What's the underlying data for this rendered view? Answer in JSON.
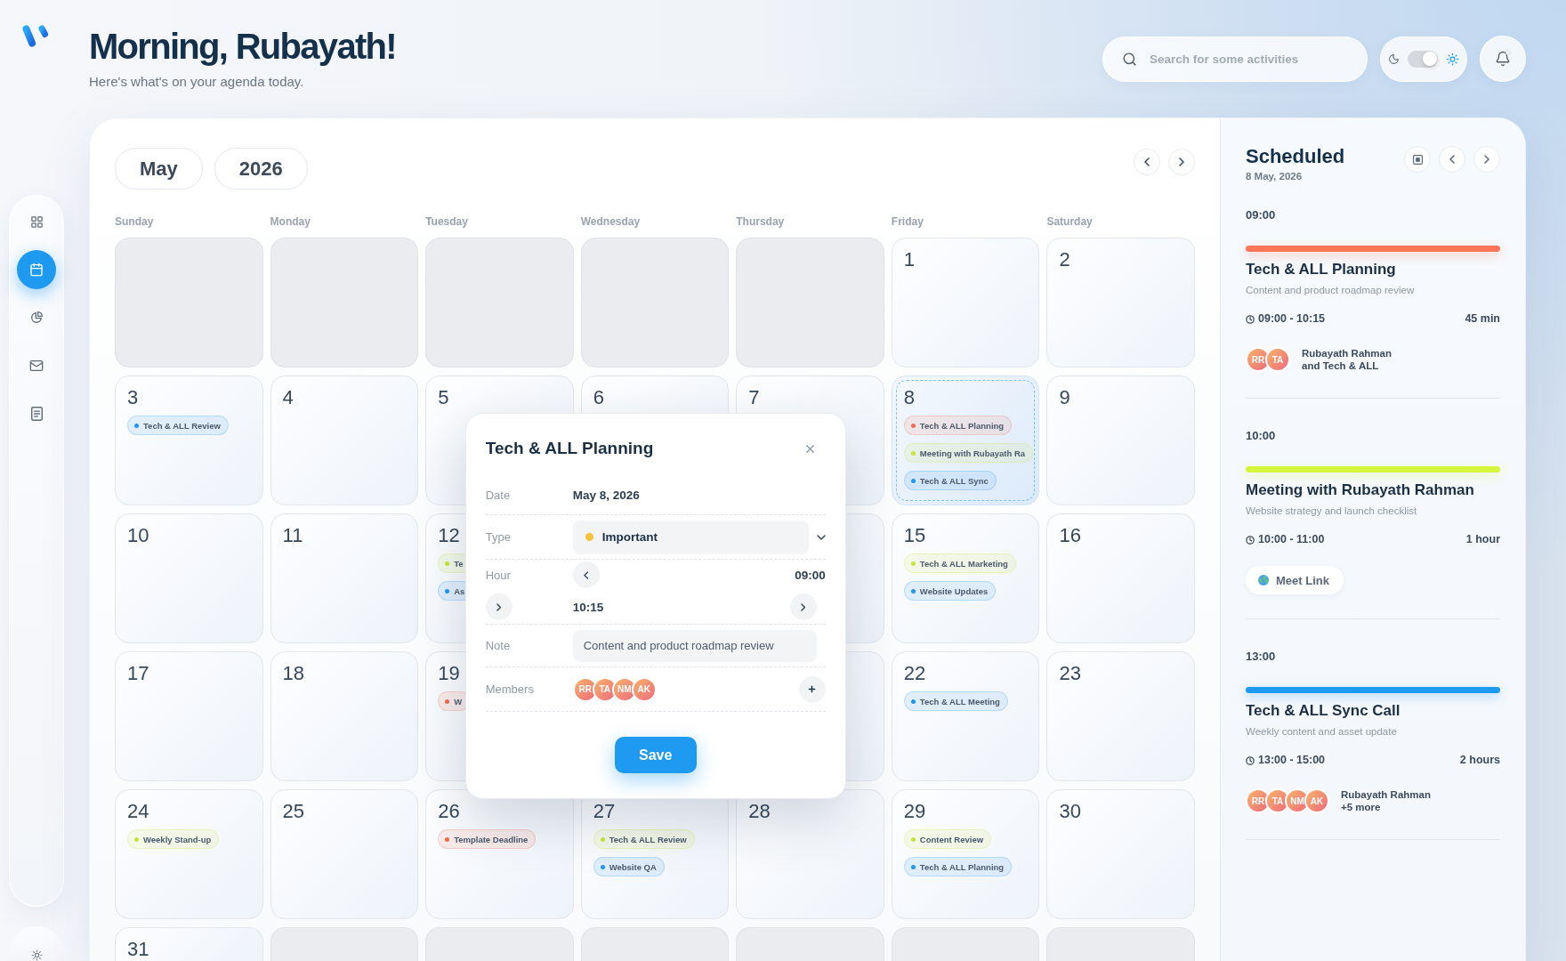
{
  "header": {
    "title": "Morning, Rubayath!",
    "subtitle": "Here's what's on your agenda today."
  },
  "search": {
    "placeholder": "Search for some activities"
  },
  "theme_toggle": {
    "light": true
  },
  "notifications": {
    "unread": true
  },
  "sidebar": {
    "items": [
      {
        "kind": "dashboard",
        "selected": false
      },
      {
        "kind": "calendar",
        "selected": true
      },
      {
        "kind": "analytics",
        "selected": false
      },
      {
        "kind": "mail",
        "selected": false
      },
      {
        "kind": "documents",
        "selected": false
      }
    ]
  },
  "calendar": {
    "month": "May",
    "year": "2026",
    "weekdays": [
      "Sunday",
      "Monday",
      "Tuesday",
      "Wednesday",
      "Thursday",
      "Friday",
      "Saturday"
    ],
    "weeks": [
      [
        {
          "outside": true,
          "selected": false
        },
        {
          "outside": true,
          "selected": false
        },
        {
          "outside": true,
          "selected": false
        },
        {
          "outside": true,
          "selected": false
        },
        {
          "outside": true,
          "selected": false
        },
        {
          "day": "1",
          "outside": false,
          "selected": false
        },
        {
          "day": "2",
          "outside": false,
          "selected": false
        }
      ],
      [
        {
          "day": "3",
          "outside": false,
          "selected": false,
          "events": [
            {
              "title": "Tech & ALL Review",
              "color": "#2196f3"
            }
          ]
        },
        {
          "day": "4",
          "outside": false,
          "selected": false
        },
        {
          "day": "5",
          "outside": false,
          "selected": false
        },
        {
          "day": "6",
          "outside": false,
          "selected": false
        },
        {
          "day": "7",
          "outside": false,
          "selected": false
        },
        {
          "day": "8",
          "outside": false,
          "selected": true,
          "events": [
            {
              "title": "Tech & ALL Planning",
              "color": "#f4694c"
            },
            {
              "title": "Meeting with Rubayath Ra",
              "color": "#c6e637"
            },
            {
              "title": "Tech & ALL Sync",
              "color": "#2196f3"
            }
          ]
        },
        {
          "day": "9",
          "outside": false,
          "selected": false
        }
      ],
      [
        {
          "day": "10",
          "outside": false,
          "selected": false
        },
        {
          "day": "11",
          "outside": false,
          "selected": false
        },
        {
          "day": "12",
          "outside": false,
          "selected": false,
          "events": [
            {
              "title": "Te",
              "color": "#c6e637"
            },
            {
              "title": "As",
              "color": "#2196f3"
            }
          ]
        },
        {
          "outside": false,
          "selected": false
        },
        {
          "day": "15",
          "outside": false,
          "selected": false,
          "events": [
            {
              "title": "Tech & ALL Marketing",
              "color": "#c6e637"
            },
            {
              "title": "Website Updates",
              "color": "#2196f3"
            }
          ]
        },
        {
          "day": "16",
          "outside": false,
          "selected": false
        }
      ],
      [
        {
          "day": "17",
          "outside": false,
          "selected": false
        },
        {
          "day": "18",
          "outside": false,
          "selected": false
        },
        {
          "day": "19",
          "outside": false,
          "selected": false,
          "events": [
            {
              "title": "W",
              "color": "#f4694c"
            }
          ]
        },
        {
          "outside": false,
          "selected": false
        },
        {
          "day": "22",
          "outside": false,
          "selected": false,
          "events": [
            {
              "title": "Tech & ALL Meeting",
              "color": "#2196f3"
            }
          ]
        },
        {
          "day": "23",
          "outside": false,
          "selected": false
        }
      ],
      [
        {
          "day": "24",
          "outside": false,
          "selected": false,
          "events": [
            {
              "title": "Weekly Stand-up",
              "color": "#c6e637"
            }
          ]
        },
        {
          "day": "25",
          "outside": false,
          "selected": false
        },
        {
          "day": "26",
          "outside": false,
          "selected": false,
          "events": [
            {
              "title": "Template Deadline",
              "color": "#f4694c"
            }
          ]
        },
        {
          "day": "27",
          "outside": false,
          "selected": false,
          "events": [
            {
              "title": "Tech & ALL Review",
              "color": "#c6e637"
            },
            {
              "title": "Website QA",
              "color": "#2196f3"
            }
          ]
        },
        {
          "day": "28",
          "outside": false,
          "selected": false
        },
        {
          "day": "29",
          "outside": false,
          "selected": false,
          "events": [
            {
              "title": "Content Review",
              "color": "#c6e637"
            },
            {
              "title": "Tech & ALL Planning",
              "color": "#2196f3"
            }
          ]
        },
        {
          "day": "30",
          "outside": false,
          "selected": false
        }
      ],
      [
        {
          "day": "31",
          "outside": false,
          "selected": false
        },
        {
          "outside": true,
          "selected": false
        },
        {
          "outside": true,
          "selected": false
        },
        {
          "outside": true,
          "selected": false
        },
        {
          "outside": true,
          "selected": false
        },
        {
          "outside": true,
          "selected": false
        },
        {
          "outside": true,
          "selected": false
        }
      ]
    ]
  },
  "modal": {
    "title": "Tech & ALL Planning",
    "fields": [
      {
        "kind": "text",
        "label": "Date",
        "value": "May 8, 2026"
      },
      {
        "kind": "select",
        "label": "Type",
        "value": "Important",
        "color": "#f7c23b"
      },
      {
        "kind": "hours",
        "label": "Hour",
        "start": "09:00",
        "end": "10:15"
      },
      {
        "kind": "input",
        "label": "Note",
        "value": "Content and product roadmap review"
      },
      {
        "kind": "members",
        "label": "Members",
        "members": [
          "RR",
          "TA",
          "NM",
          "AK"
        ]
      }
    ],
    "save": "Save"
  },
  "scheduled": {
    "title": "Scheduled",
    "date": "8 May, 2026",
    "items": [
      {
        "kind": "members",
        "time": "09:00",
        "color": "#ff7756",
        "title": "Tech & ALL Planning",
        "description": "Content and product roadmap review",
        "range": "09:00 - 10:15",
        "duration": "45 min",
        "members": [
          "RR",
          "TA"
        ],
        "people": "Rubayath Rahman and Tech & ALL"
      },
      {
        "kind": "link",
        "time": "10:00",
        "color": "#d4f53c",
        "title": "Meeting with Rubayath Rahman",
        "description": "Website strategy and launch checklist",
        "range": "10:00 - 11:00",
        "duration": "1 hour",
        "link": "Meet Link"
      },
      {
        "kind": "members",
        "time": "13:00",
        "color": "#1e9bf0",
        "title": "Tech & ALL Sync Call",
        "description": "Weekly content and asset update",
        "range": "13:00 - 15:00",
        "duration": "2 hours",
        "members": [
          "RR",
          "TA",
          "NM",
          "AK"
        ],
        "people": "Rubayath Rahman +5 more"
      }
    ]
  }
}
